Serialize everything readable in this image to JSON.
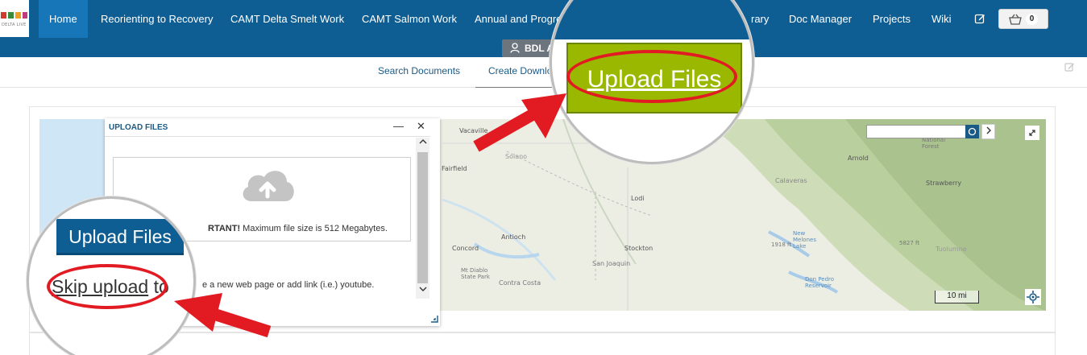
{
  "logo": {
    "tagline": "DELTA LIVE"
  },
  "nav": {
    "items": [
      "Home",
      "Reorienting to Recovery",
      "CAMT Delta Smelt Work",
      "CAMT Salmon Work",
      "Annual and Progre",
      "rary",
      "Doc Manager",
      "Projects",
      "Wiki"
    ],
    "cart_count": "0",
    "user_label": "BDL A"
  },
  "subnav": {
    "search": "Search Documents",
    "create": "Create Downlo"
  },
  "upload_panel": {
    "title": "UPLOAD FILES",
    "minimize": "—",
    "close": "✕",
    "important": "RTANT!",
    "size_note": " Maximum file size is 512 Megabytes.",
    "link_note": "e a new web page or add link (i.e.) youtube."
  },
  "map": {
    "labels": [
      "Vacaville",
      "Solano",
      "Fairfield",
      "Lodi",
      "Antioch",
      "Concord",
      "Stockton",
      "San Joaquin",
      "Mt Diablo State Park",
      "Contra Costa",
      "Calaveras",
      "Arnold",
      "National Forest",
      "Strawberry",
      "New Melones Lake",
      "1918 ft",
      "Don Pedro Reservoir",
      "Tuolumne",
      "5827 ft"
    ],
    "scale": "10 mi"
  },
  "callouts": {
    "left_button": "Upload Files",
    "left_skip_underlined": "Skip upload",
    "left_skip_rest": " to",
    "right_button": "Upload Files"
  },
  "colors": {
    "nav_bg": "#0e5e94",
    "nav_active": "#1676b8",
    "accent_green": "#9bb800",
    "highlight_red": "#e21b23"
  }
}
